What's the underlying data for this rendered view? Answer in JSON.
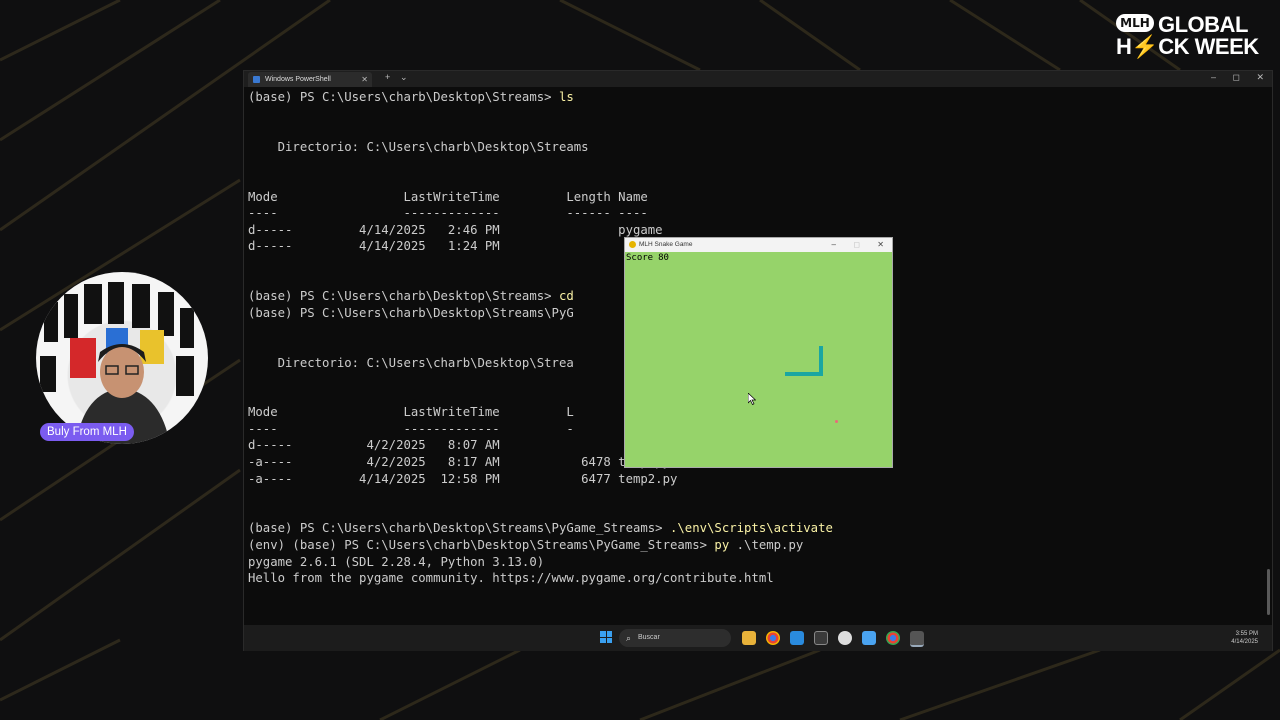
{
  "branding": {
    "badge": "MLH",
    "line1": "GLOBAL",
    "line2": "H⚡CK WEEK"
  },
  "presenter": {
    "name": "Buly From MLH"
  },
  "terminal": {
    "tab_title": "Windows PowerShell",
    "lines": [
      [
        {
          "t": "(base) PS C:\\Users\\charb\\Desktop\\Streams> "
        },
        {
          "t": "ls",
          "c": "cmd"
        }
      ],
      [],
      [],
      [
        {
          "t": "    Directorio: C:\\Users\\charb\\Desktop\\Streams"
        }
      ],
      [],
      [],
      [
        {
          "t": "Mode                 LastWriteTime         Length Name"
        }
      ],
      [
        {
          "t": "----                 -------------         ------ ----"
        }
      ],
      [
        {
          "t": "d-----         4/14/2025   2:46 PM                pygame"
        }
      ],
      [
        {
          "t": "d-----         4/14/2025   1:24 PM"
        }
      ],
      [],
      [],
      [
        {
          "t": "(base) PS C:\\Users\\charb\\Desktop\\Streams> "
        },
        {
          "t": "cd",
          "c": "cmd"
        }
      ],
      [
        {
          "t": "(base) PS C:\\Users\\charb\\Desktop\\Streams\\PyG"
        }
      ],
      [],
      [],
      [
        {
          "t": "    Directorio: C:\\Users\\charb\\Desktop\\Strea"
        }
      ],
      [],
      [],
      [
        {
          "t": "Mode                 LastWriteTime         L"
        }
      ],
      [
        {
          "t": "----                 -------------         -"
        }
      ],
      [
        {
          "t": "d-----          4/2/2025   8:07 AM"
        }
      ],
      [
        {
          "t": "-a----          4/2/2025   8:17 AM           6478 temp.py"
        }
      ],
      [
        {
          "t": "-a----         4/14/2025  12:58 PM           6477 temp2.py"
        }
      ],
      [],
      [],
      [
        {
          "t": "(base) PS C:\\Users\\charb\\Desktop\\Streams\\PyGame_Streams> "
        },
        {
          "t": ".\\env\\Scripts\\activate",
          "c": "cmd"
        }
      ],
      [
        {
          "t": "(env) (base) PS C:\\Users\\charb\\Desktop\\Streams\\PyGame_Streams> "
        },
        {
          "t": "py",
          "c": "cmd"
        },
        {
          "t": " .\\temp.py"
        }
      ],
      [
        {
          "t": "pygame 2.6.1 (SDL 2.28.4, Python 3.13.0)"
        }
      ],
      [
        {
          "t": "Hello from the pygame community. https://www.pygame.org/contribute.html"
        }
      ]
    ]
  },
  "taskbar": {
    "search_placeholder": "Buscar",
    "time": "3:55 PM",
    "date": "4/14/2025"
  },
  "game": {
    "title": "MLH Snake Game",
    "score_label": "Score",
    "score_value": "80"
  },
  "colors": {
    "game_bg": "#96d36a",
    "snake": "#1aa6a2",
    "food": "#e86b7a",
    "terminal_bg": "#0c0c0c",
    "command_text": "#f9f1a5"
  }
}
